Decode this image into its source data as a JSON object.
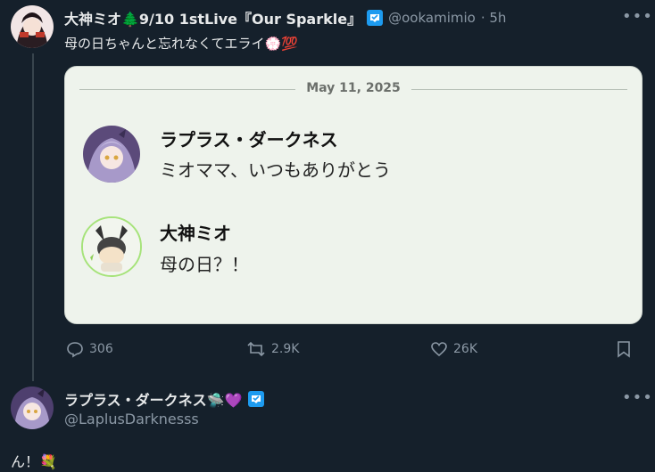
{
  "tweet": {
    "author_name": "大神ミオ🌲9/10 1stLive『Our Sparkle』",
    "author_handle": "@ookamimio",
    "time": "· 5h",
    "text": "母の日ちゃんと忘れなくてエライ💮💯",
    "more_label": "•••",
    "card": {
      "date": "May 11, 2025",
      "messages": [
        {
          "name": "ラプラス・ダークネス",
          "text": "ミオママ、いつもありがとう"
        },
        {
          "name": "大神ミオ",
          "text": "母の日？！"
        }
      ]
    },
    "actions": {
      "replies": "306",
      "retweets": "2.9K",
      "likes": "26K"
    }
  },
  "reply": {
    "author_name": "ラプラス・ダークネス🛸💜",
    "author_handle": "@LaplusDarknesss",
    "text": "ん！💐",
    "more_label": "•••"
  },
  "colors": {
    "background": "#15202b",
    "text": "#e7e9ea",
    "secondary": "#8b98a5",
    "verified": "#1d9bf0",
    "card_bg": "#eef3ec"
  }
}
